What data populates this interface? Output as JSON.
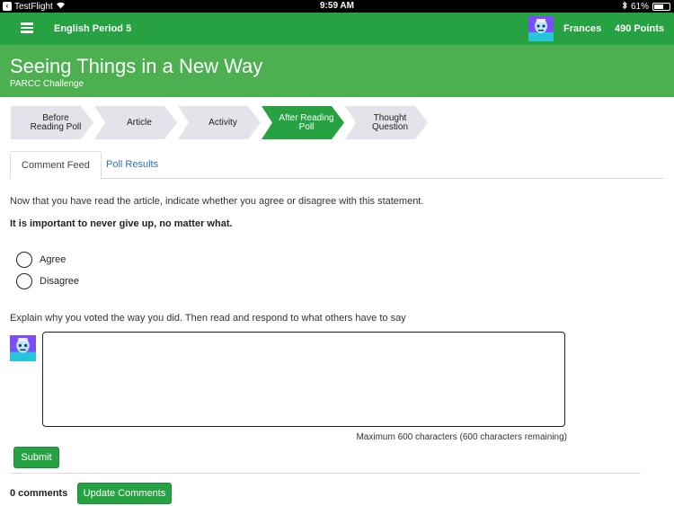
{
  "status_bar": {
    "app": "TestFlight",
    "time": "9:59 AM",
    "battery": "61%",
    "battery_level": 0.61
  },
  "nav": {
    "menu_icon": "hamburger-menu-icon",
    "course": "English Period 5",
    "user_name": "Frances",
    "points": "490 Points"
  },
  "header": {
    "title": "Seeing Things in a New Way",
    "subtitle": "PARCC Challenge"
  },
  "steps": [
    {
      "label": "Before Reading Poll",
      "active": false
    },
    {
      "label": "Article",
      "active": false
    },
    {
      "label": "Activity",
      "active": false
    },
    {
      "label": "After Reading Poll",
      "active": true
    },
    {
      "label": "Thought Question",
      "active": false
    }
  ],
  "tabs": {
    "comment_feed": "Comment Feed",
    "poll_results": "Poll Results"
  },
  "poll": {
    "intro": "Now that you have read the article, indicate whether you agree or disagree with this statement.",
    "statement": "It is important to never give up, no matter what.",
    "options": [
      "Agree",
      "Disagree"
    ]
  },
  "comment": {
    "prompt": "Explain why you voted the way you did. Then read and respond to what others have to say",
    "value": "",
    "max_chars": "Maximum 600 characters (600 characters remaining)",
    "submit": "Submit"
  },
  "feed": {
    "count": "0 comments",
    "update": "Update Comments"
  },
  "colors": {
    "nav_green": "#27a243",
    "header_green": "#4caf50",
    "step_inactive": "#e3e3ec",
    "link_blue": "#2a72b5"
  }
}
